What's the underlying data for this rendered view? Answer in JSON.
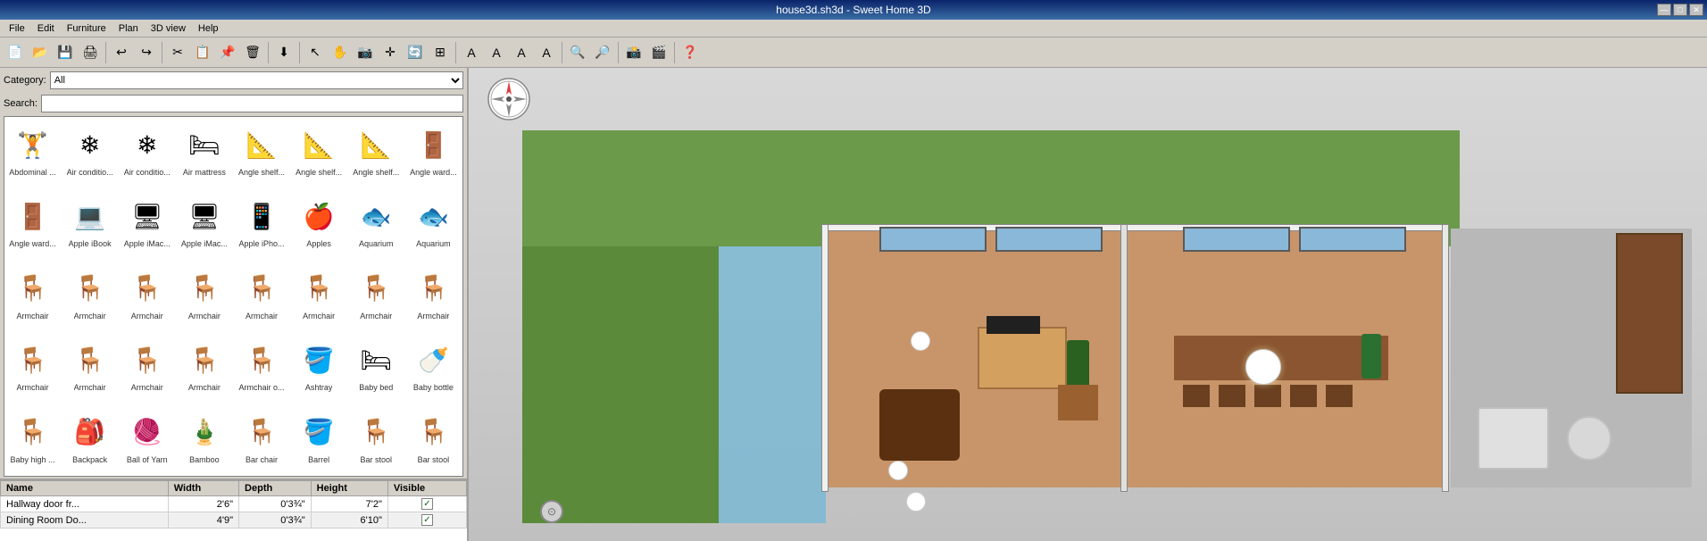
{
  "titlebar": {
    "title": "house3d.sh3d - Sweet Home 3D",
    "min": "—",
    "max": "□",
    "close": "✕"
  },
  "menubar": {
    "items": [
      "File",
      "Edit",
      "Furniture",
      "Plan",
      "3D view",
      "Help"
    ]
  },
  "category": {
    "label": "Category:",
    "value": "All"
  },
  "search": {
    "label": "Search:",
    "placeholder": ""
  },
  "furniture": [
    {
      "name": "Abdominal ...",
      "icon": "🏋"
    },
    {
      "name": "Air conditio...",
      "icon": "❄"
    },
    {
      "name": "Air conditio...",
      "icon": "❄"
    },
    {
      "name": "Air mattress",
      "icon": "🛏"
    },
    {
      "name": "Angle shelf...",
      "icon": "📐"
    },
    {
      "name": "Angle shelf...",
      "icon": "📐"
    },
    {
      "name": "Angle shelf...",
      "icon": "📐"
    },
    {
      "name": "Angle ward...",
      "icon": "🚪"
    },
    {
      "name": "Angle ward...",
      "icon": "🚪"
    },
    {
      "name": "Apple iBook",
      "icon": "💻"
    },
    {
      "name": "Apple iMac...",
      "icon": "🖥"
    },
    {
      "name": "Apple iMac...",
      "icon": "🖥"
    },
    {
      "name": "Apple iPho...",
      "icon": "📱"
    },
    {
      "name": "Apples",
      "icon": "🍎"
    },
    {
      "name": "Aquarium",
      "icon": "🐟"
    },
    {
      "name": "Aquarium",
      "icon": "🐟"
    },
    {
      "name": "Armchair",
      "icon": "🪑"
    },
    {
      "name": "Armchair",
      "icon": "🪑"
    },
    {
      "name": "Armchair",
      "icon": "🪑"
    },
    {
      "name": "Armchair",
      "icon": "🪑"
    },
    {
      "name": "Armchair",
      "icon": "🪑"
    },
    {
      "name": "Armchair",
      "icon": "🪑"
    },
    {
      "name": "Armchair",
      "icon": "🪑"
    },
    {
      "name": "Armchair",
      "icon": "🪑"
    },
    {
      "name": "Armchair",
      "icon": "🪑"
    },
    {
      "name": "Armchair",
      "icon": "🪑"
    },
    {
      "name": "Armchair",
      "icon": "🪑"
    },
    {
      "name": "Armchair",
      "icon": "🪑"
    },
    {
      "name": "Armchair o...",
      "icon": "🪑"
    },
    {
      "name": "Ashtray",
      "icon": "🪣"
    },
    {
      "name": "Baby bed",
      "icon": "🛏"
    },
    {
      "name": "Baby bottle",
      "icon": "🍼"
    },
    {
      "name": "Baby high ...",
      "icon": "🪑"
    },
    {
      "name": "Backpack",
      "icon": "🎒"
    },
    {
      "name": "Ball of Yarn",
      "icon": "🧶"
    },
    {
      "name": "Bamboo",
      "icon": "🎍"
    },
    {
      "name": "Bar chair",
      "icon": "🪑"
    },
    {
      "name": "Barrel",
      "icon": "🪣"
    },
    {
      "name": "Bar stool",
      "icon": "🪑"
    },
    {
      "name": "Bar stool",
      "icon": "🪑"
    }
  ],
  "table": {
    "columns": [
      "Name",
      "Width",
      "Depth",
      "Height",
      "Visible"
    ],
    "rows": [
      {
        "name": "Hallway door fr...",
        "width": "2'6\"",
        "depth": "0'3¾\"",
        "height": "7'2\"",
        "visible": true
      },
      {
        "name": "Dining Room Do...",
        "width": "4'9\"",
        "depth": "0'3¾\"",
        "height": "6'10\"",
        "visible": true
      }
    ]
  }
}
